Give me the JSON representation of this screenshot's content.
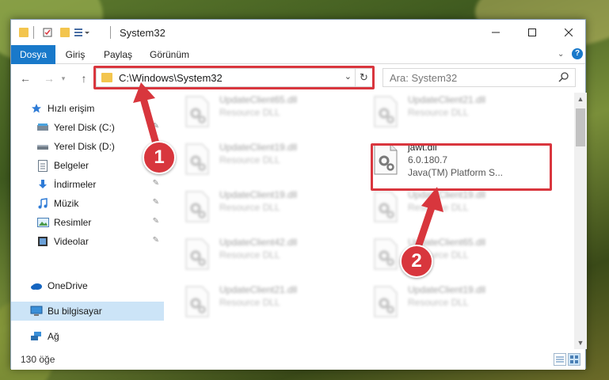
{
  "window": {
    "title": "System32"
  },
  "ribbon": {
    "tabs": [
      "Dosya",
      "Giriş",
      "Paylaş",
      "Görünüm"
    ]
  },
  "address": {
    "path": "C:\\Windows\\System32"
  },
  "search": {
    "placeholder": "Ara: System32"
  },
  "sidebar": {
    "items": [
      {
        "label": "Hızlı erişim",
        "icon": "star-icon",
        "pinned": false
      },
      {
        "label": "Yerel Disk (C:)",
        "icon": "drive-icon",
        "pinned": true
      },
      {
        "label": "Yerel Disk (D:)",
        "icon": "drive-icon",
        "pinned": false
      },
      {
        "label": "Belgeler",
        "icon": "document-icon",
        "pinned": true
      },
      {
        "label": "İndirmeler",
        "icon": "download-icon",
        "pinned": true
      },
      {
        "label": "Müzik",
        "icon": "music-icon",
        "pinned": true
      },
      {
        "label": "Resimler",
        "icon": "pictures-icon",
        "pinned": true
      },
      {
        "label": "Videolar",
        "icon": "video-icon",
        "pinned": true
      },
      {
        "label": "OneDrive",
        "icon": "cloud-icon",
        "pinned": false
      },
      {
        "label": "Bu bilgisayar",
        "icon": "computer-icon",
        "pinned": false,
        "selected": true
      },
      {
        "label": "Ağ",
        "icon": "network-icon",
        "pinned": false
      }
    ]
  },
  "files": [
    {
      "name": "UpdateClient65.dll",
      "type": "Resource DLL",
      "blurred": true
    },
    {
      "name": "UpdateClient21.dll",
      "type": "Resource DLL",
      "blurred": true
    },
    {
      "name": "UpdateClient19.dll",
      "type": "Resource DLL",
      "blurred": true
    },
    {
      "name": "jawt.dll",
      "type": "6.0.180.7",
      "desc": "Java(TM) Platform S...",
      "blurred": false
    },
    {
      "name": "UpdateClient19.dll",
      "type": "Resource DLL",
      "blurred": true
    },
    {
      "name": "UpdateClient19.dll",
      "type": "Resource DLL",
      "blurred": true
    },
    {
      "name": "UpdateClient42.dll",
      "type": "Resource DLL",
      "blurred": true
    },
    {
      "name": "UpdateClient65.dll",
      "type": "Resource DLL",
      "blurred": true
    },
    {
      "name": "UpdateClient21.dll",
      "type": "Resource DLL",
      "blurred": true
    },
    {
      "name": "UpdateClient19.dll",
      "type": "Resource DLL",
      "blurred": true
    }
  ],
  "status": {
    "item_count": "130 öğe"
  },
  "annotations": {
    "step1": "1",
    "step2": "2",
    "color": "#d8363d"
  },
  "colors": {
    "accent": "#1979ca",
    "selection": "#cce4f7",
    "highlight": "#d9363e"
  }
}
